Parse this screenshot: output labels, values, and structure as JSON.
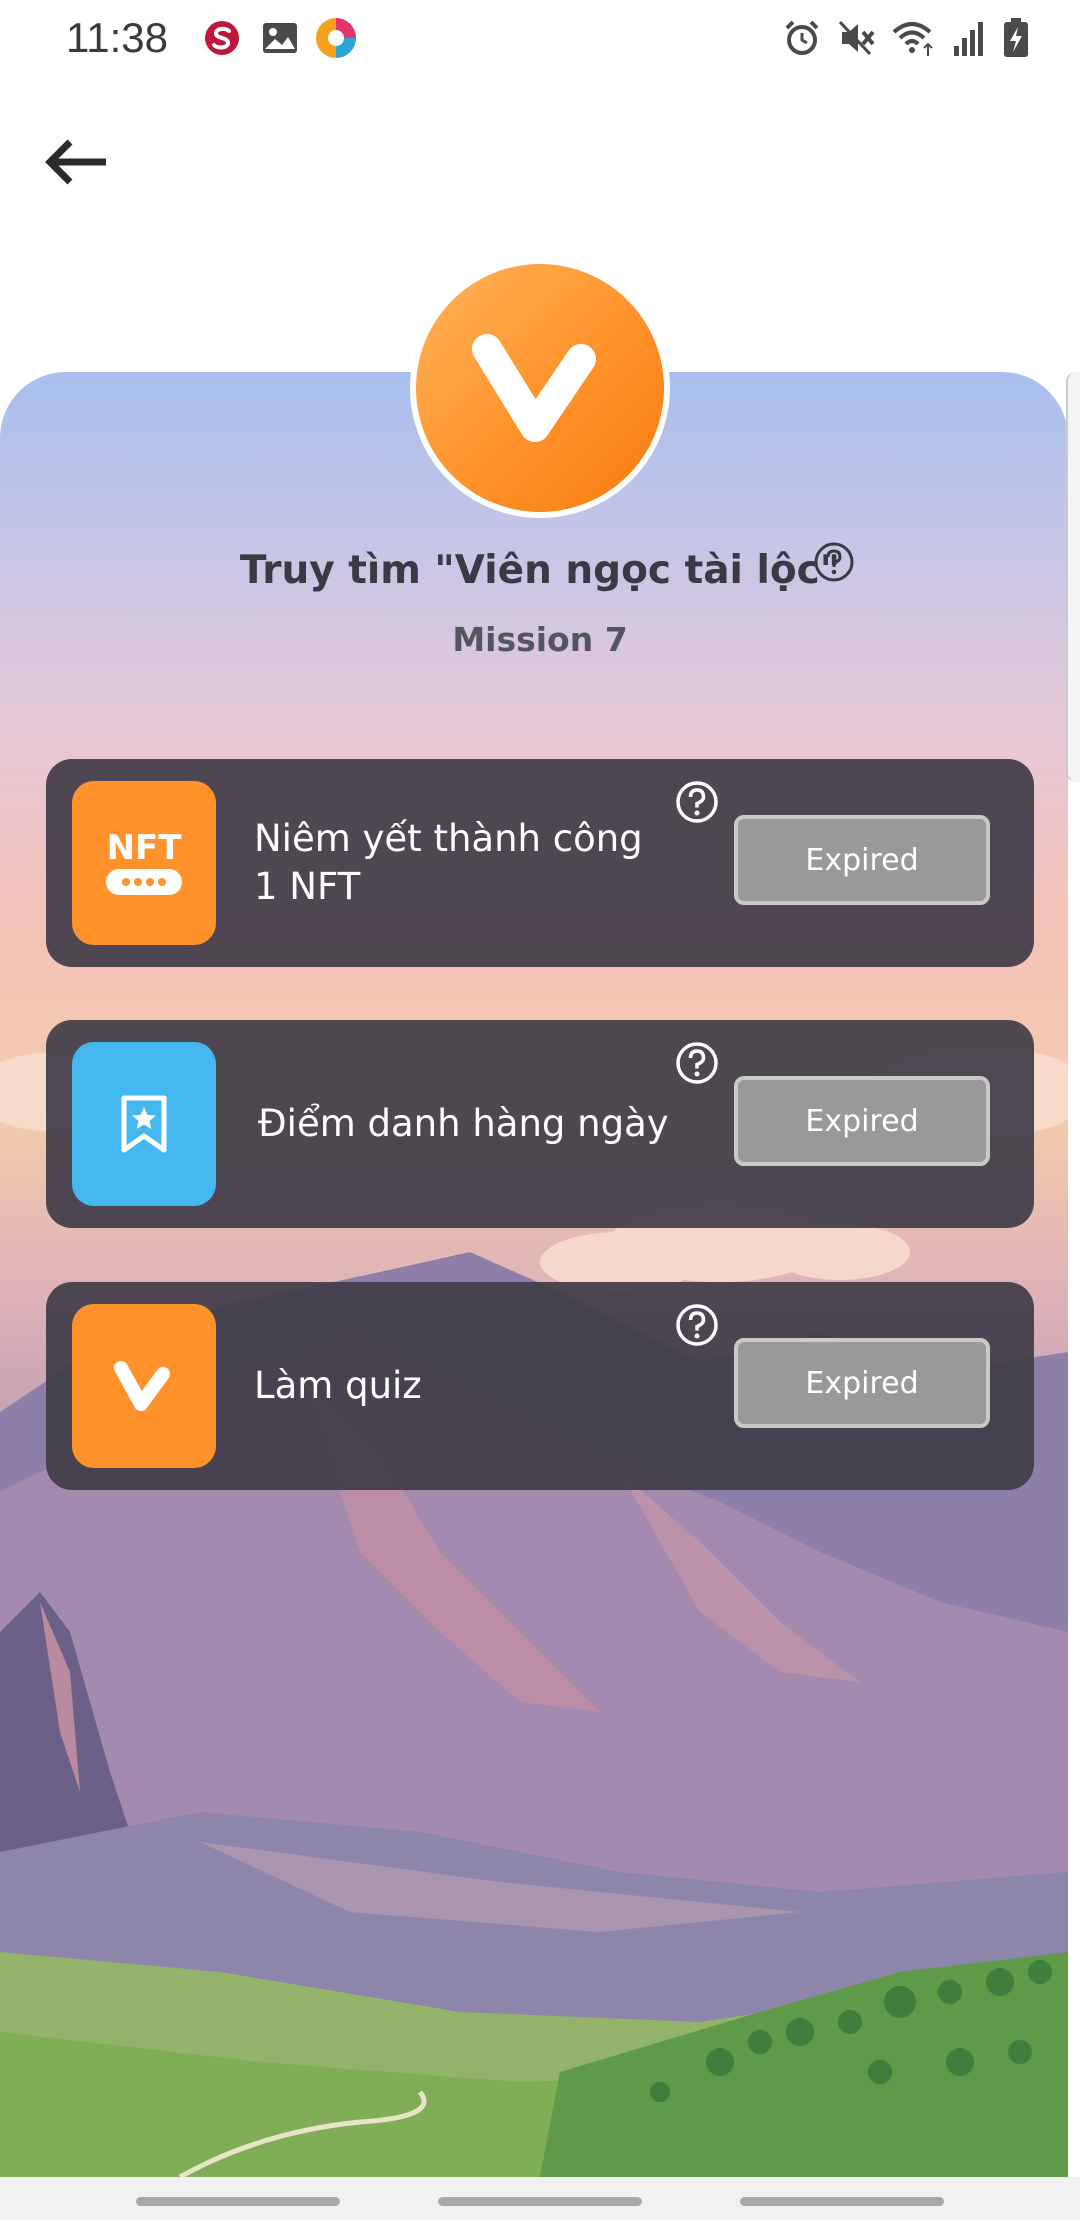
{
  "status_bar": {
    "time": "11:38",
    "left_icons": [
      "s-app-icon",
      "gallery-icon",
      "browser-app-icon"
    ],
    "right_icons": [
      "alarm-icon",
      "mute-icon",
      "wifi-icon",
      "signal-icon",
      "battery-charging-icon"
    ]
  },
  "header": {
    "back_icon": "arrow-left-icon"
  },
  "mission": {
    "title": "Truy tìm \"Viên ngọc tài lộc\"",
    "subtitle": "Mission 7",
    "help_icon": "question-circle-icon",
    "logo_icon": "v-logo-icon"
  },
  "tasks": [
    {
      "label": "Niêm yết thành công 1 NFT",
      "icon": "nft-icon",
      "icon_text": "NFT",
      "icon_color": "#ff922a",
      "button": "Expired"
    },
    {
      "label": "Điểm danh hàng ngày",
      "icon": "bookmark-star-icon",
      "icon_color": "#45b8f0",
      "button": "Expired"
    },
    {
      "label": "Làm quiz",
      "icon": "v-logo-icon",
      "icon_color": "#ff922a",
      "button": "Expired"
    }
  ],
  "colors": {
    "accent": "#ff922a",
    "task_bg": "#403c48",
    "button_bg": "#999999"
  }
}
